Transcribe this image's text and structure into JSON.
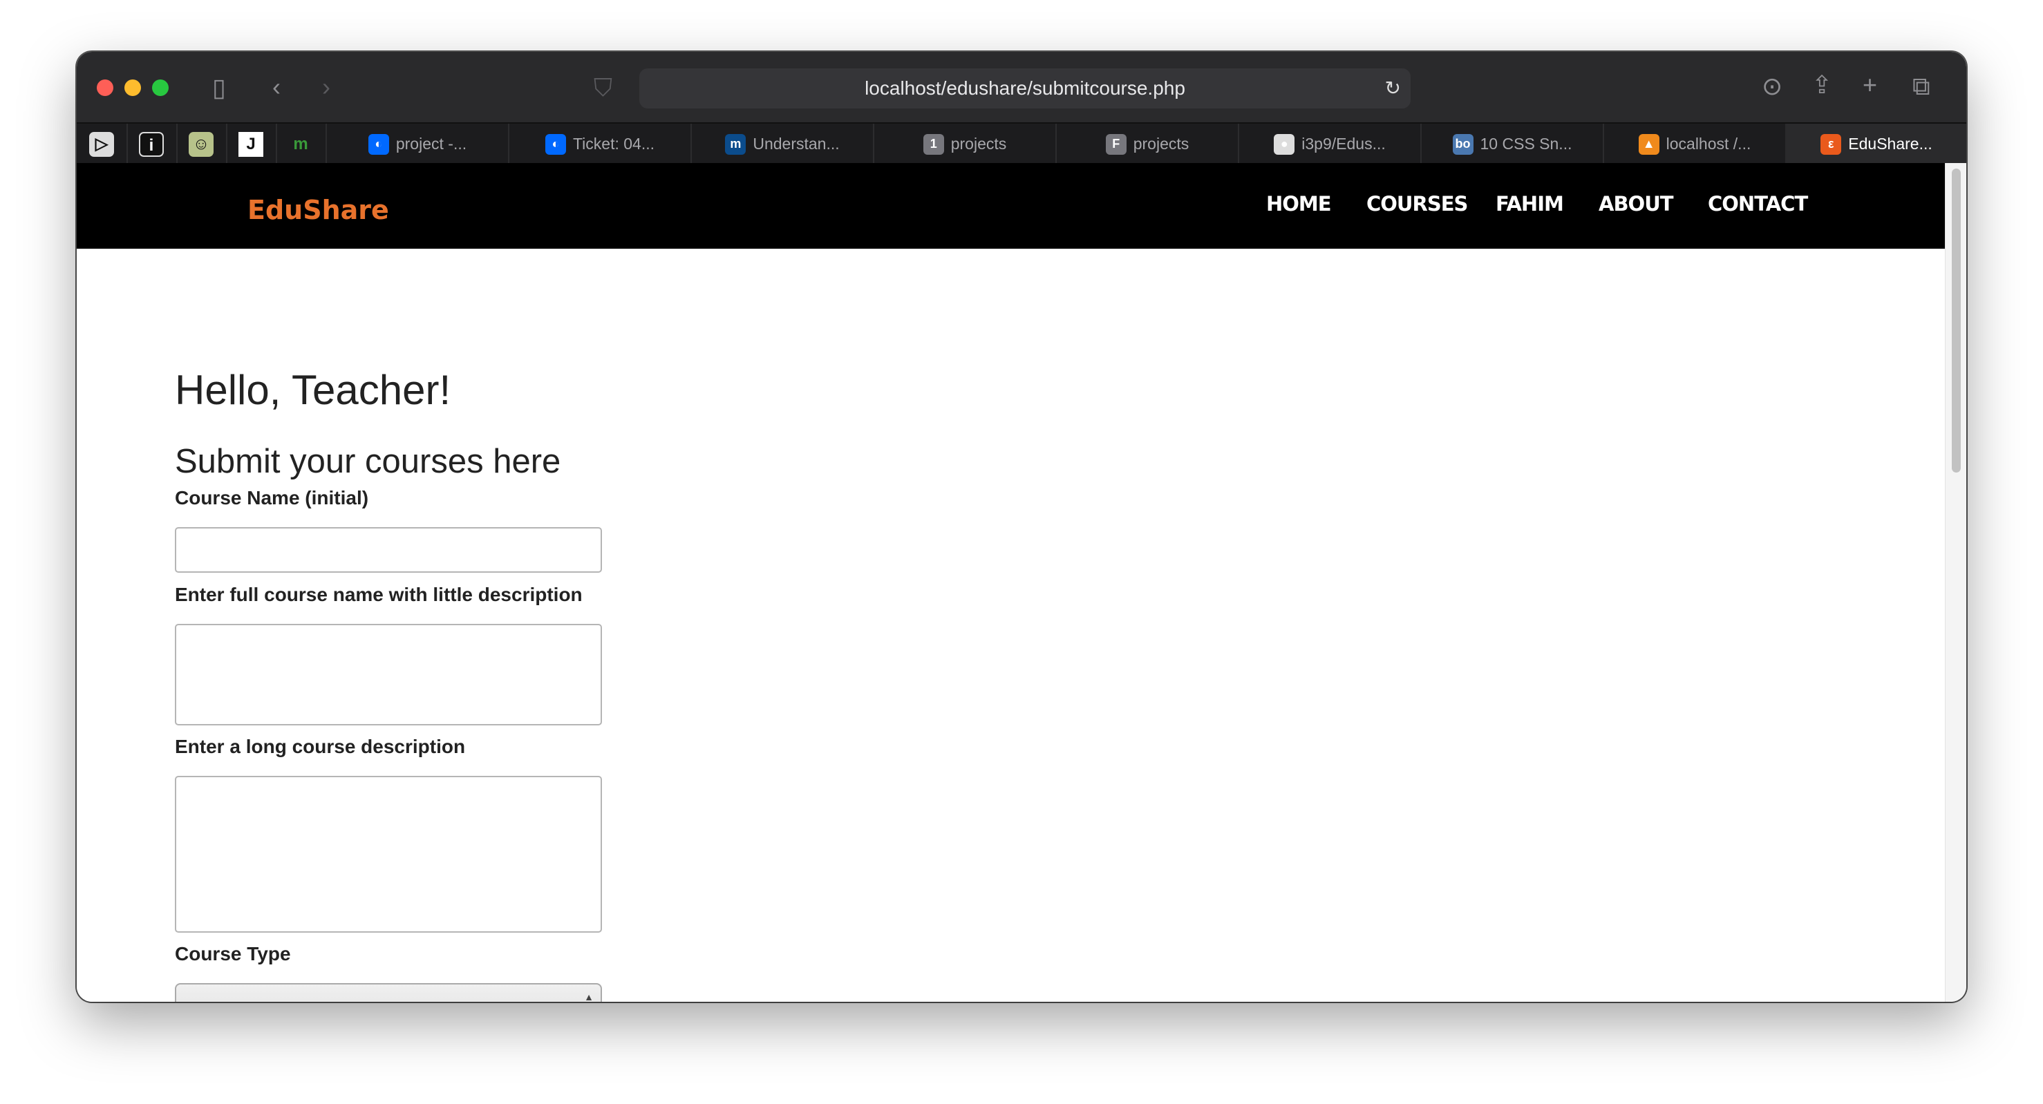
{
  "browser": {
    "url": "localhost/edushare/submitcourse.php",
    "pinned_tabs": [
      "▷",
      "i",
      "☺",
      "J",
      "m"
    ],
    "tabs": [
      {
        "label": "project -...",
        "icon": "digitalocean-icon",
        "color": "#0069ff",
        "glyph": "◐"
      },
      {
        "label": "Ticket: 04...",
        "icon": "digitalocean-icon",
        "color": "#0069ff",
        "glyph": "◐"
      },
      {
        "label": "Understan...",
        "icon": "m-icon",
        "color": "#0b4c8c",
        "glyph": "m"
      },
      {
        "label": "projects",
        "icon": "badge-1-icon",
        "color": "#77777d",
        "glyph": "1"
      },
      {
        "label": "projects",
        "icon": "badge-f-icon",
        "color": "#77777d",
        "glyph": "F"
      },
      {
        "label": "i3p9/Edus...",
        "icon": "github-icon",
        "color": "#dddddd",
        "glyph": "●"
      },
      {
        "label": "10 CSS Sn...",
        "icon": "bo-icon",
        "color": "#4a78b0",
        "glyph": "bo"
      },
      {
        "label": "localhost /...",
        "icon": "phpmyadmin-icon",
        "color": "#f08a1c",
        "glyph": "▲"
      },
      {
        "label": "EduShare...",
        "icon": "xampp-icon",
        "color": "#ea5a1c",
        "glyph": "ε"
      }
    ]
  },
  "site": {
    "logo": "EduShare",
    "brand_color": "#e8722c",
    "nav": [
      "HOME",
      "COURSES",
      "FAHIM",
      "ABOUT",
      "CONTACT"
    ]
  },
  "form": {
    "greeting": "Hello, Teacher!",
    "subtitle": "Submit your courses here",
    "course_name_label": "Course Name (initial)",
    "course_name_value": "",
    "full_name_label": "Enter full course name with little description",
    "full_name_value": "",
    "long_desc_label": "Enter a long course description",
    "long_desc_value": "",
    "course_type_label": "Course Type"
  }
}
